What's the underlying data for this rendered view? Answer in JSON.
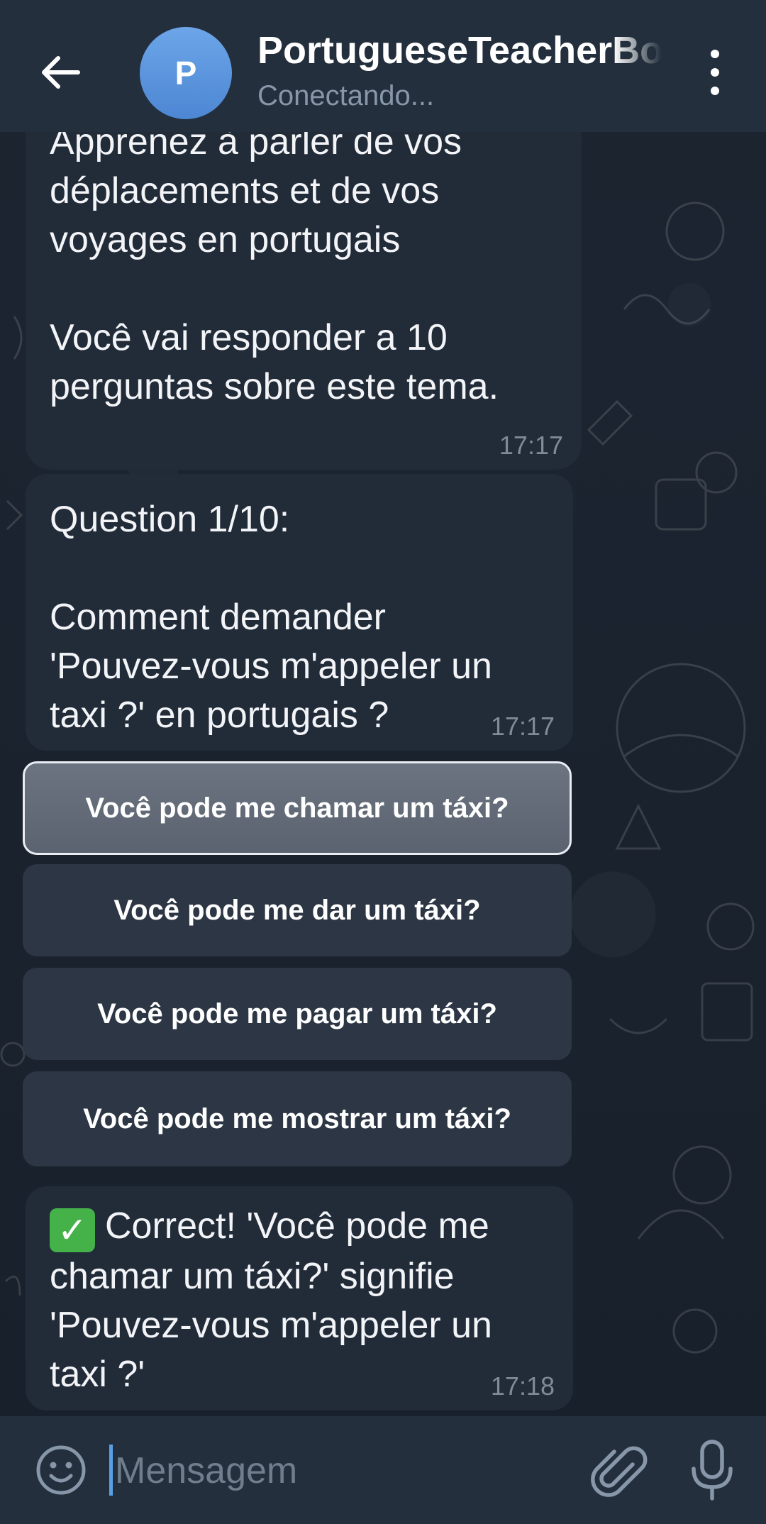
{
  "header": {
    "back_icon": "arrow-left-icon",
    "avatar_letter": "P",
    "avatar_color": "#5b93dd",
    "title": "PortugueseTeacherBot",
    "status": "Conectando...",
    "menu_icon": "more-vertical-icon"
  },
  "messages": [
    {
      "text": "Apprenez à parler de vos\ndéplacements et de vos\nvoyages en portugais\n\nVocê vai responder a 10\nperguntas sobre este tema.",
      "time": "17:17"
    },
    {
      "text": "Question 1/10:\n\nComment demander\n'Pouvez-vous m'appeler un\ntaxi ?' en portugais ?",
      "time": "17:17"
    },
    {
      "emoji": "✓",
      "text": "Correct! 'Você pode me\nchamar um táxi?' signifie\n'Pouvez-vous m'appeler un\ntaxi ?'",
      "time": "17:18"
    }
  ],
  "keyboard": {
    "options": [
      {
        "label": "Você pode me chamar um táxi?",
        "selected": true
      },
      {
        "label": "Você pode me dar um táxi?",
        "selected": false
      },
      {
        "label": "Você pode me pagar um táxi?",
        "selected": false
      },
      {
        "label": "Você pode me mostrar um táxi?",
        "selected": false
      }
    ]
  },
  "input": {
    "placeholder": "Mensagem",
    "value": "",
    "emoji_icon": "smiley-icon",
    "attach_icon": "paperclip-icon",
    "mic_icon": "microphone-icon"
  },
  "colors": {
    "bar_background": "#232f3d",
    "bubble_background": "#222b38",
    "accent": "#5a9fe6",
    "check_green": "#44b249"
  }
}
